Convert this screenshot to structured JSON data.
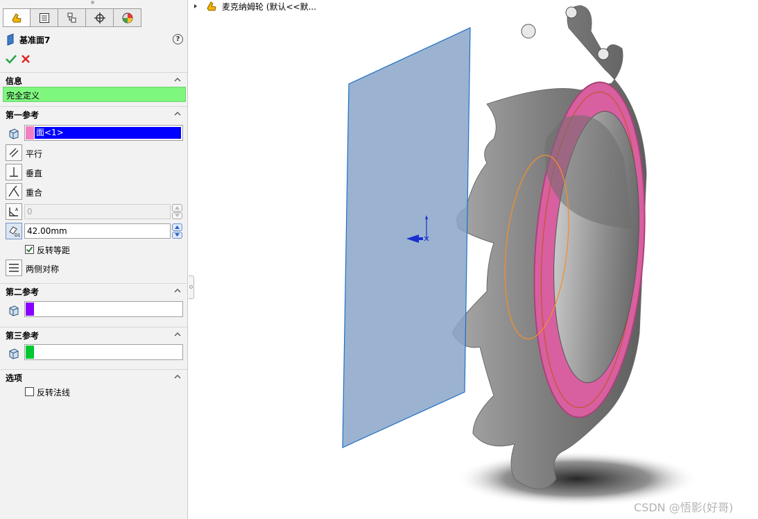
{
  "tabs": [
    {
      "name": "feature-manager",
      "icon": "feature-manager-icon"
    },
    {
      "name": "property-manager",
      "icon": "property-manager-icon"
    },
    {
      "name": "configuration-manager",
      "icon": "configuration-manager-icon"
    },
    {
      "name": "dimxpert-manager",
      "icon": "dimxpert-icon"
    },
    {
      "name": "display-manager",
      "icon": "display-manager-icon"
    }
  ],
  "feature": {
    "title": "基准面7",
    "help": "?"
  },
  "sections": {
    "info": {
      "label": "信息",
      "status": "完全定义",
      "status_color": "#7ff77f"
    },
    "first_reference": {
      "label": "第一参考",
      "selection": "面<1>",
      "swatch_color": "#f37ec2",
      "selection_bg": "#0000ff",
      "options": {
        "parallel": "平行",
        "perpendicular": "垂直",
        "coincident": "重合"
      },
      "angle_value": "0",
      "distance_value": "42.00mm",
      "flip_offset_label": "反转等距",
      "flip_offset_checked": true,
      "mid_plane_label": "两侧对称"
    },
    "second_reference": {
      "label": "第二参考",
      "swatch_color": "#8a00ff"
    },
    "third_reference": {
      "label": "第三参考",
      "swatch_color": "#00c832"
    },
    "options": {
      "label": "选项",
      "flip_normal_label": "反转法线",
      "flip_normal_checked": false
    }
  },
  "tree": {
    "label": "麦克纳姆轮 (默认<<默..."
  },
  "watermark": "CSDN @悟影(好哥)",
  "colors": {
    "plane": "#8aa6c8",
    "plane_edge": "#1f6fc7",
    "wheel_face": "#d85fa0",
    "wheel_body": "#8f8f8f",
    "highlight_loop": "#f0902a",
    "triad": "#1a2fd0"
  }
}
